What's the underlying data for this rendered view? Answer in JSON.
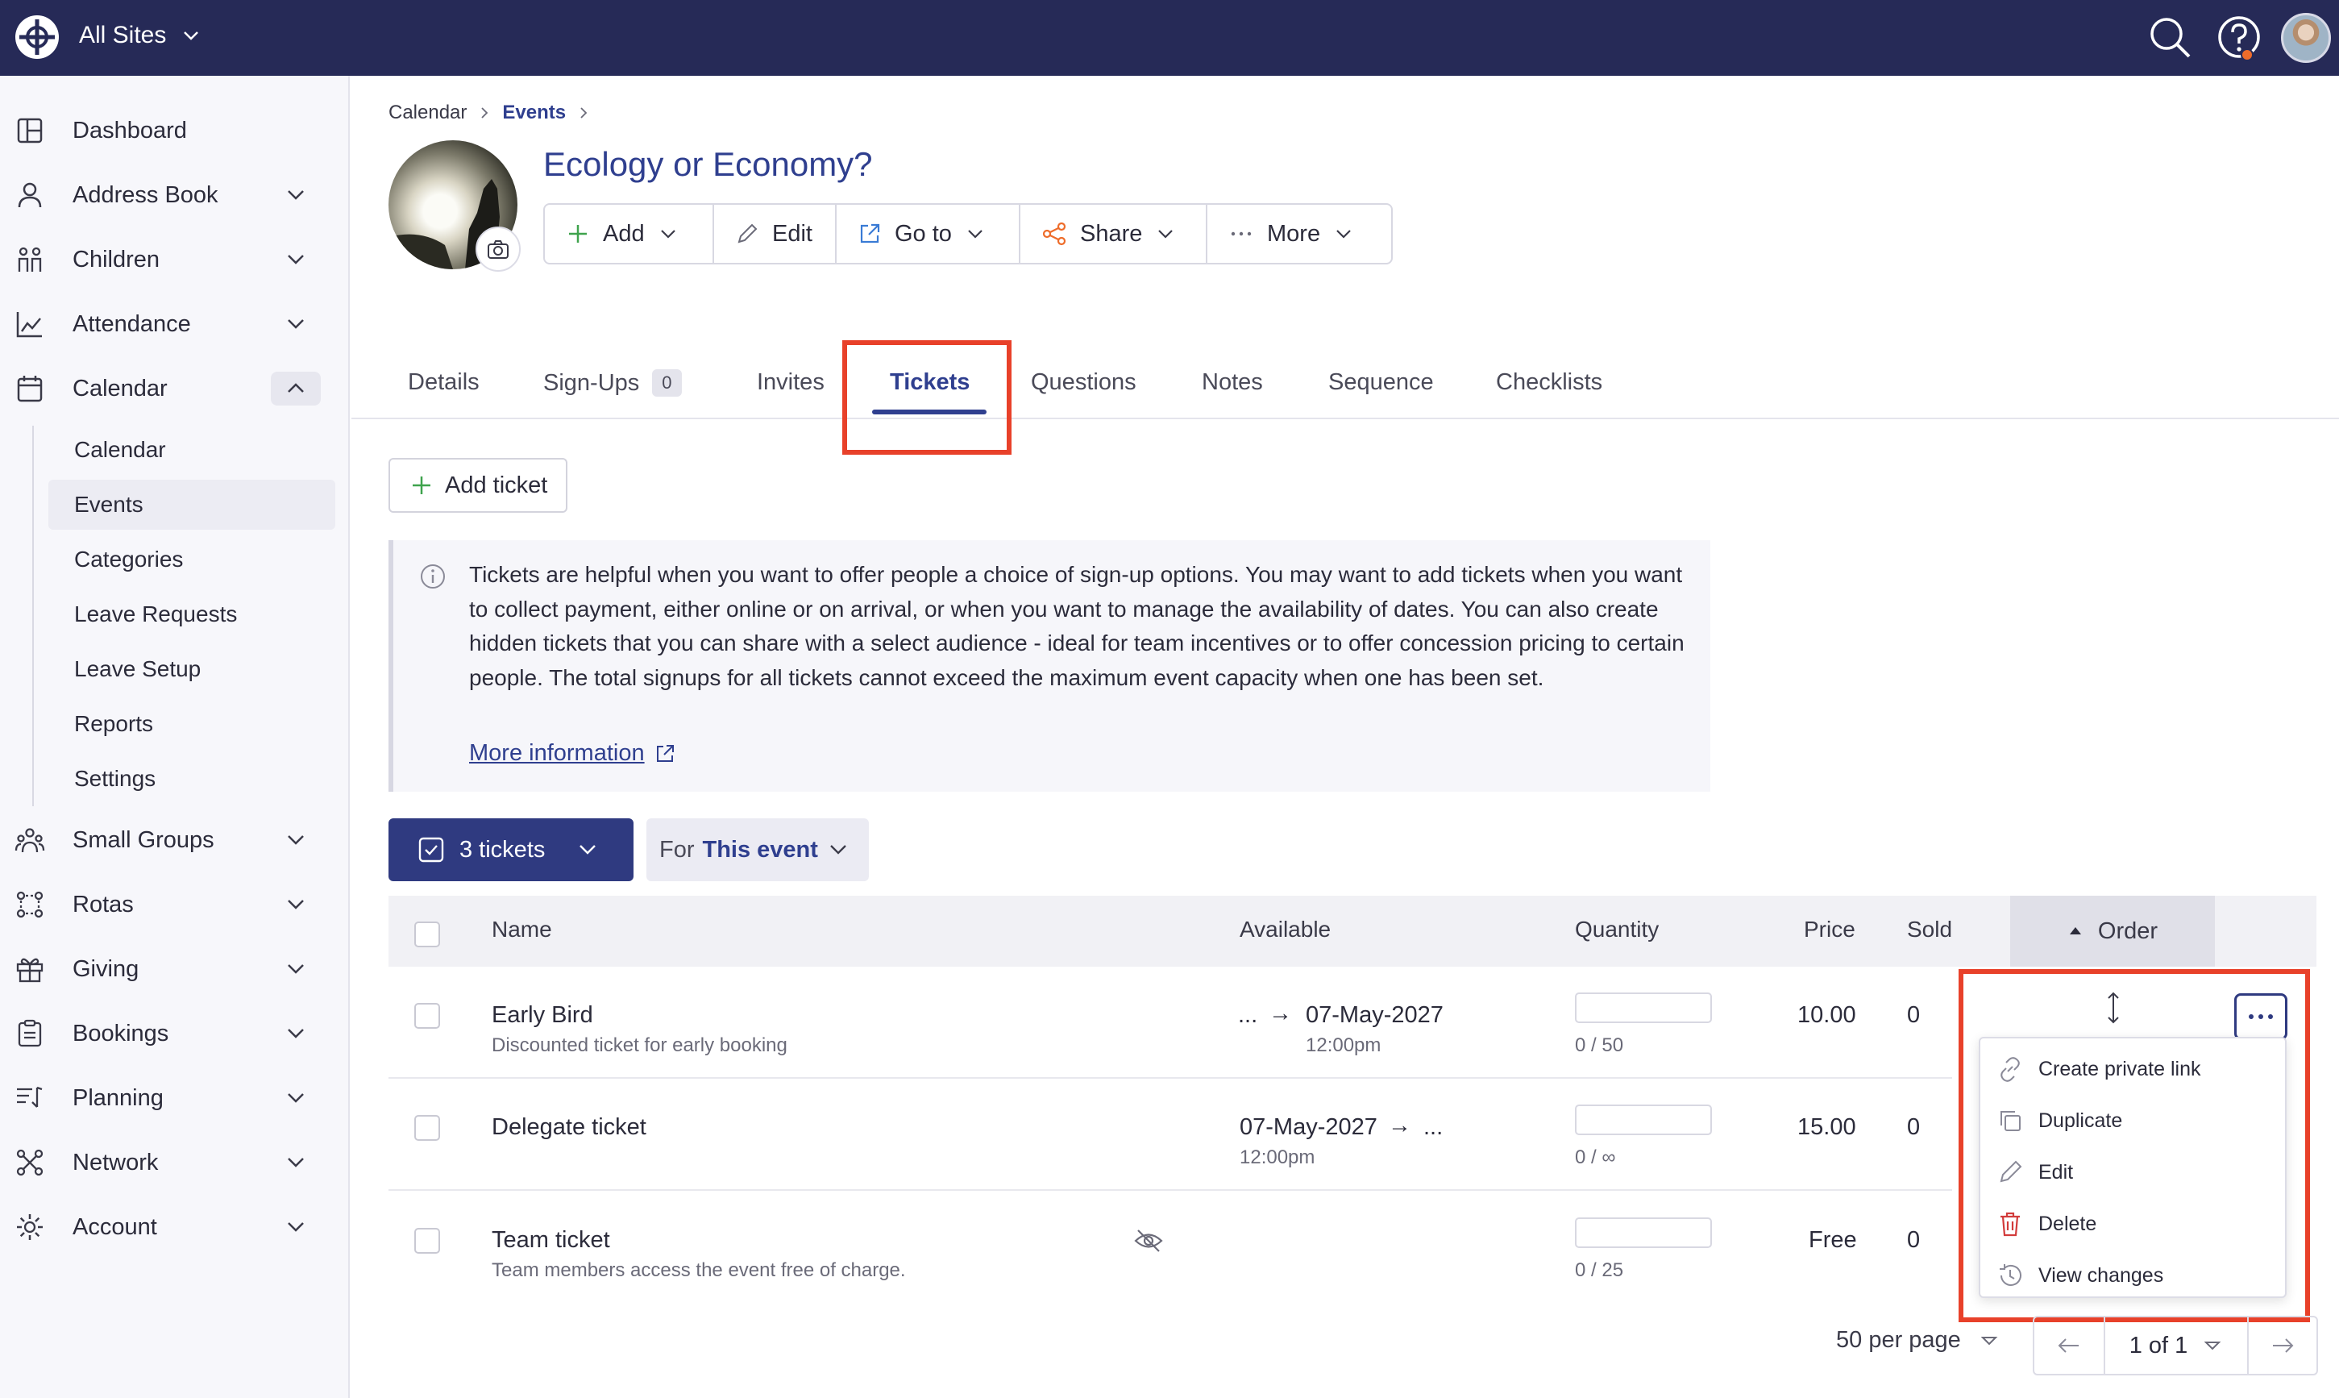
{
  "topbar": {
    "site_label": "All Sites",
    "icons": [
      "menu-logo-icon",
      "search-icon",
      "help-icon",
      "avatar"
    ]
  },
  "sidebar": {
    "items": [
      {
        "label": "Dashboard",
        "icon": "dashboard-icon"
      },
      {
        "label": "Address Book",
        "icon": "person-icon"
      },
      {
        "label": "Children",
        "icon": "children-icon"
      },
      {
        "label": "Attendance",
        "icon": "chart-icon"
      },
      {
        "label": "Calendar",
        "icon": "calendar-icon"
      },
      {
        "label": "Small Groups",
        "icon": "group-icon"
      },
      {
        "label": "Rotas",
        "icon": "rotas-icon"
      },
      {
        "label": "Giving",
        "icon": "gift-icon"
      },
      {
        "label": "Bookings",
        "icon": "bookings-icon"
      },
      {
        "label": "Planning",
        "icon": "planning-icon"
      },
      {
        "label": "Network",
        "icon": "network-icon"
      },
      {
        "label": "Account",
        "icon": "settings-icon"
      }
    ],
    "calendar_sub": [
      "Calendar",
      "Events",
      "Categories",
      "Leave Requests",
      "Leave Setup",
      "Reports",
      "Settings"
    ],
    "active_sub": "Events"
  },
  "breadcrumb": {
    "root": "Calendar",
    "current": "Events"
  },
  "event": {
    "title": "Ecology or Economy?"
  },
  "toolbar": {
    "add": "Add",
    "edit": "Edit",
    "goto": "Go to",
    "share": "Share",
    "more": "More"
  },
  "tabs": {
    "details": "Details",
    "signups": "Sign-Ups",
    "signups_count": "0",
    "invites": "Invites",
    "tickets": "Tickets",
    "questions": "Questions",
    "notes": "Notes",
    "sequence": "Sequence",
    "checklists": "Checklists"
  },
  "add_ticket": "Add ticket",
  "info": {
    "text": "Tickets are helpful when you want to offer people a choice of sign-up options. You may want to add tickets when you want to collect payment, either online or on arrival, or when you want to manage the availability of dates. You can also create hidden tickets that you can share with a select audience - ideal for team incentives or to offer concession pricing to certain people. The total signups for all tickets cannot exceed the maximum event capacity when one has been set.",
    "link": "More information"
  },
  "filters": {
    "tickets": "3 tickets",
    "for_prefix": "For",
    "for_value": "This event"
  },
  "table": {
    "headers": {
      "name": "Name",
      "available": "Available",
      "quantity": "Quantity",
      "price": "Price",
      "sold": "Sold",
      "order": "Order"
    },
    "rows": [
      {
        "name": "Early Bird",
        "desc": "Discounted ticket for early booking",
        "from": "...",
        "arrow": "→",
        "to": "07-May-2027",
        "to_time": "12:00pm",
        "from_time": "",
        "qty": "0 / 50",
        "price": "10.00",
        "sold": "0",
        "hidden": false
      },
      {
        "name": "Delegate ticket",
        "desc": "",
        "from": "07-May-2027",
        "arrow": "→",
        "to": "...",
        "from_time": "12:00pm",
        "to_time": "",
        "qty": "0 / ∞",
        "price": "15.00",
        "sold": "0",
        "hidden": false
      },
      {
        "name": "Team ticket",
        "desc": "Team members access the event free of charge.",
        "from": "",
        "arrow": "",
        "to": "",
        "from_time": "",
        "to_time": "",
        "qty": "0 / 25",
        "price": "Free",
        "sold": "0",
        "hidden": true
      }
    ]
  },
  "row_menu": [
    "Create private link",
    "Duplicate",
    "Edit",
    "Delete",
    "View changes"
  ],
  "pagination": {
    "per_page": "50 per page",
    "page": "1 of 1"
  },
  "colors": {
    "topbar": "#262a57",
    "accent": "#2f3f8f",
    "highlight": "#e8412a",
    "green": "#3fa34d",
    "orange": "#ee6c2a",
    "delete": "#d23b3b"
  }
}
